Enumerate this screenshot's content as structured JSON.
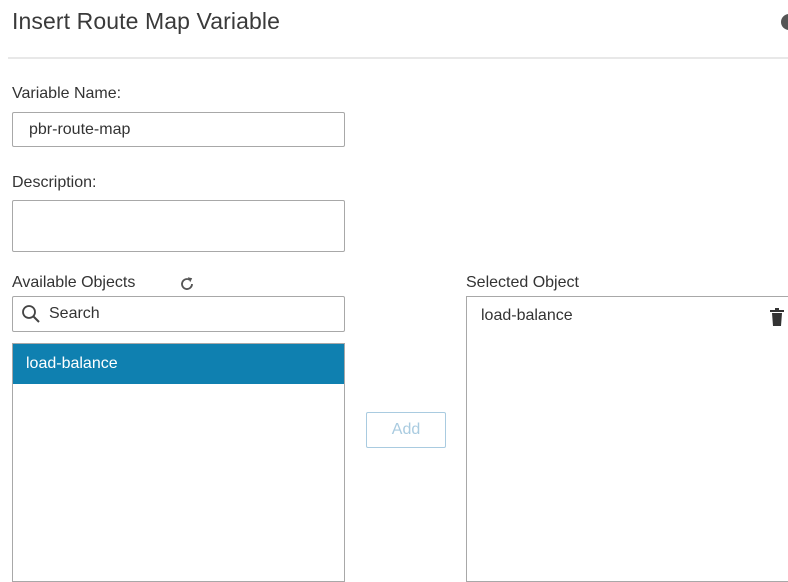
{
  "dialog": {
    "title": "Insert Route Map Variable"
  },
  "form": {
    "variable_name_label": "Variable Name:",
    "variable_name_value": "pbr-route-map",
    "description_label": "Description:",
    "description_value": ""
  },
  "available": {
    "label": "Available Objects",
    "refresh_icon": "refresh-icon",
    "search_placeholder": "Search",
    "items": [
      {
        "label": "load-balance",
        "selected": true
      }
    ]
  },
  "add_button": {
    "label": "Add",
    "enabled": false
  },
  "selected": {
    "label": "Selected Object",
    "items": [
      {
        "label": "load-balance",
        "icon": "trash-icon"
      }
    ]
  },
  "colors": {
    "selected_row": "#0f80b0",
    "disabled_button": "#a9cbe0",
    "border": "#a8a8a8"
  }
}
